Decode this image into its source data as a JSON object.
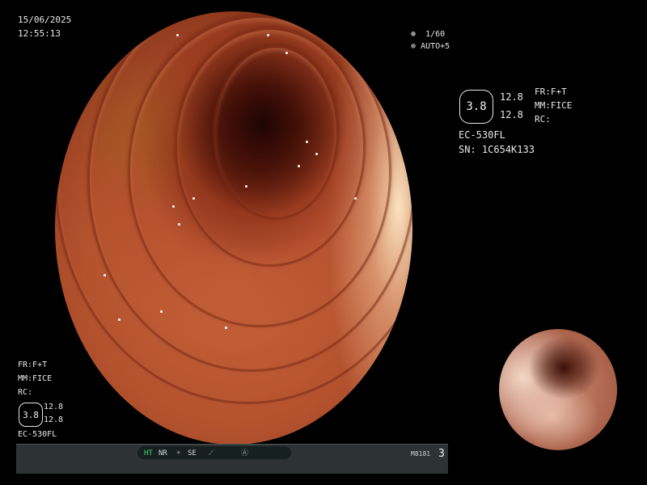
{
  "datetime": {
    "date": "15/06/2025",
    "time": "12:55:13"
  },
  "top_status": {
    "shutter": "1/60",
    "auto": "AUTO+5"
  },
  "right_info": {
    "scope_value": "3.8",
    "value_top": "12.8",
    "value_bottom": "12.8",
    "model": "EC-530FL",
    "serial": "SN: 1C654K133",
    "fr": "FR:F+T",
    "mm": "MM:FICE",
    "rc": "RC:"
  },
  "left_info": {
    "fr": "FR:F+T",
    "mm": "MM:FICE",
    "rc": "RC:",
    "scope_value": "3.8",
    "value_top": "12.8",
    "value_bottom": "12.8",
    "model": "EC-530FL"
  },
  "status_bar": {
    "ht": "HT",
    "nr": "NR",
    "se": "SE",
    "code": "M8181",
    "page": "3"
  },
  "colors": {
    "background": "#000000",
    "text": "#e8e8e8",
    "accent_green": "#4fd37a",
    "status_bar": "#2c3332"
  },
  "icons": [
    "aperture-icon",
    "camera-icon",
    "brightness-icon",
    "edge-icon",
    "circle-a-icon"
  ]
}
